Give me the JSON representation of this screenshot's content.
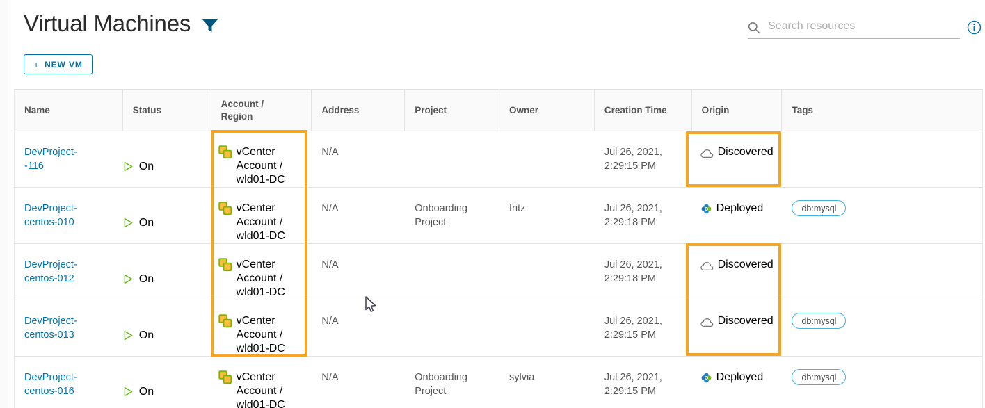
{
  "header": {
    "title": "Virtual Machines",
    "filter_icon": "filter-icon",
    "new_vm_label": "+ NEW VM",
    "new_vm_plus": "+",
    "new_vm_text": "NEW VM"
  },
  "search": {
    "placeholder": "Search resources",
    "value": "",
    "icon": "search-icon",
    "info_icon": "info-icon"
  },
  "table": {
    "columns": [
      {
        "label": "Name"
      },
      {
        "label": "Status"
      },
      {
        "label": "Account / Region",
        "line1": "Account /",
        "line2": "Region"
      },
      {
        "label": "Address"
      },
      {
        "label": "Project"
      },
      {
        "label": "Owner"
      },
      {
        "label": "Creation Time"
      },
      {
        "label": "Origin"
      },
      {
        "label": "Tags"
      }
    ],
    "rows": [
      {
        "name_line1": "DevProject-",
        "name_line2": "-116",
        "status": "On",
        "status_icon": "play-icon",
        "account_line1": "vCenter",
        "account_line2": "Account /",
        "account_line3": "wld01-DC",
        "account_icon": "vcenter-account-icon",
        "address": "N/A",
        "project": "",
        "owner": "",
        "creation_line1": "Jul 26, 2021,",
        "creation_line2": "2:29:15 PM",
        "origin": "Discovered",
        "origin_icon": "cloud-icon",
        "tags": ""
      },
      {
        "name_line1": "DevProject-",
        "name_line2": "centos-010",
        "status": "On",
        "status_icon": "play-icon",
        "account_line1": "vCenter",
        "account_line2": "Account /",
        "account_line3": "wld01-DC",
        "account_icon": "vcenter-account-icon",
        "address": "N/A",
        "project_line1": "Onboarding",
        "project_line2": "Project",
        "owner": "fritz",
        "creation_line1": "Jul 26, 2021,",
        "creation_line2": "2:29:18 PM",
        "origin": "Deployed",
        "origin_icon": "diamond-icon",
        "tags": "db:mysql"
      },
      {
        "name_line1": "DevProject-",
        "name_line2": "centos-012",
        "status": "On",
        "status_icon": "play-icon",
        "account_line1": "vCenter",
        "account_line2": "Account /",
        "account_line3": "wld01-DC",
        "account_icon": "vcenter-account-icon",
        "address": "N/A",
        "project": "",
        "owner": "",
        "creation_line1": "Jul 26, 2021,",
        "creation_line2": "2:29:18 PM",
        "origin": "Discovered",
        "origin_icon": "cloud-icon",
        "tags": ""
      },
      {
        "name_line1": "DevProject-",
        "name_line2": "centos-013",
        "status": "On",
        "status_icon": "play-icon",
        "account_line1": "vCenter",
        "account_line2": "Account /",
        "account_line3": "wld01-DC",
        "account_icon": "vcenter-account-icon",
        "address": "N/A",
        "project": "",
        "owner": "",
        "creation_line1": "Jul 26, 2021,",
        "creation_line2": "2:29:15 PM",
        "origin": "Discovered",
        "origin_icon": "cloud-icon",
        "tags": "db:mysql"
      },
      {
        "name_line1": "DevProject-",
        "name_line2": "centos-016",
        "status": "On",
        "status_icon": "play-icon",
        "account_line1": "vCenter",
        "account_line2": "Account /",
        "account_line3": "wld01-DC",
        "account_icon": "vcenter-account-icon",
        "address": "N/A",
        "project_line1": "Onboarding",
        "project_line2": "Project",
        "owner": "sylvia",
        "creation_line1": "Jul 26, 2021,",
        "creation_line2": "2:29:15 PM",
        "origin": "Deployed",
        "origin_icon": "diamond-icon",
        "tags": "db:mysql"
      }
    ]
  },
  "annotations": {
    "color": "#f5a623",
    "boxes": [
      {
        "name": "account-region-column-highlight"
      },
      {
        "name": "origin-row1-highlight"
      },
      {
        "name": "origin-row3-4-highlight"
      }
    ]
  },
  "colors": {
    "link": "#0076ad",
    "accent": "#0072a3",
    "text": "#565656",
    "tag_border": "#45b0e3",
    "status_on": "#60b515",
    "highlight": "#f5a623"
  },
  "cursor": {
    "icon": "mouse-pointer"
  }
}
